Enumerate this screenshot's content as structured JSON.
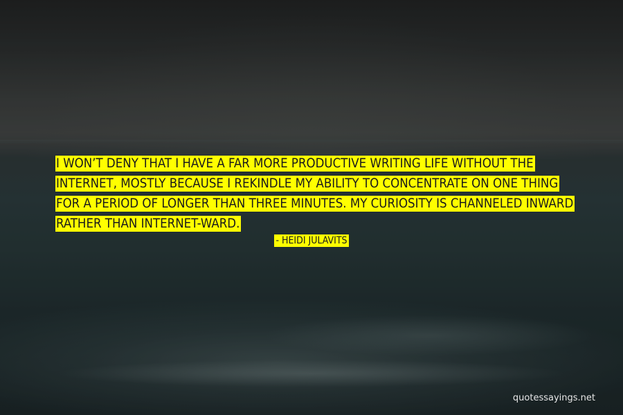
{
  "quote": {
    "text": "I won’t deny that I have a far more productive writing life without the internet, mostly because I rekindle my ability to concentrate on one thing for a period of longer than three minutes. My curiosity is channeled inward rather than internet-ward.",
    "author_line": "- Heidi Julavits"
  },
  "watermark": {
    "site": "quotessayings.net"
  },
  "colors": {
    "highlight": "#ffff00",
    "text": "#1b1b1b",
    "watermark": "#e6e6e6"
  }
}
